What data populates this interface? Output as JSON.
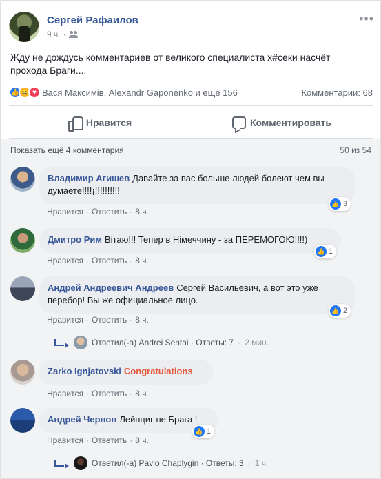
{
  "post": {
    "author": "Сергей Рафаилов",
    "time": "9 ч.",
    "audience_icon": "friends-icon",
    "text": "Жду не дождусь комментариев от великого специалиста х#секи насчёт прохода Браги....",
    "reactions_text": "Вася Максимів, Alexandr Gaponenko и ещё 156",
    "comments_count": "Комментарии: 68",
    "more_label": "•••"
  },
  "actions": {
    "like_label": "Нравится",
    "comment_label": "Комментировать"
  },
  "comments_header": {
    "show_more": "Показать ещё 4 комментария",
    "pager": "50 из 54"
  },
  "common": {
    "like_label": "Нравится",
    "reply_label": "Ответить",
    "dot": "·"
  },
  "comments": [
    {
      "name": "Владимир Агишев",
      "text": "Давайте за вас больше людей болеют чем вы думаете!!!!¡!!!!!!!!!!",
      "likes": "3",
      "time": "8 ч."
    },
    {
      "name": "Дмитро Рим",
      "text": "Вітаю!!! Тепер в Німеччину - за ПЕРЕМОГОЮ!!!!)",
      "likes": "1",
      "time": "8 ч."
    },
    {
      "name": "Андрей Андреевич Андреев",
      "text": "Сергей Васильевич, а вот это уже перебор! Вы же официальное лицо.",
      "likes": "2",
      "time": "8 ч."
    },
    {
      "name": "Zarko Ignjatovski",
      "text": "Congratulations",
      "likes": "",
      "time": "8 ч."
    },
    {
      "name": "Андрей Чернов",
      "text": "Лейпциг не Брага !",
      "likes": "1",
      "time": "8 ч."
    }
  ],
  "replies": [
    {
      "text": "Ответил(-а) Andrei Sentai · Ответы: 7",
      "time": "2 мин."
    },
    {
      "text": "Ответил(-а) Pavlo Chaplygin · Ответы: 3",
      "time": "1 ч."
    }
  ],
  "colors": {
    "link": "#385898",
    "like": "#2078f4",
    "highlight": "#e2593b"
  }
}
